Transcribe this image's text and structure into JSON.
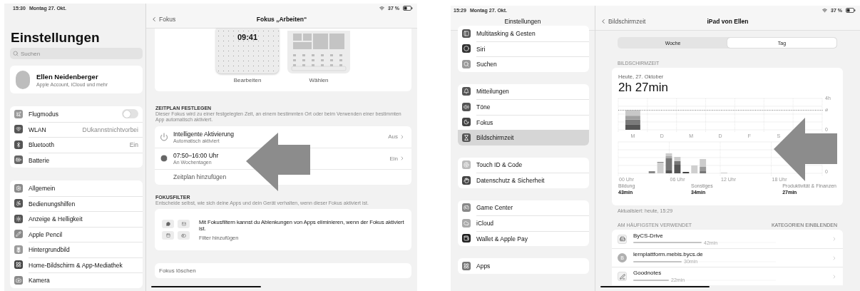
{
  "left_screen": {
    "status_bar": {
      "time": "15:30",
      "date": "Montag 27. Okt.",
      "battery": "37 %"
    },
    "sidebar": {
      "title": "Einstellungen",
      "search": {
        "placeholder": "Suchen"
      },
      "profile": {
        "name": "Ellen Neidenberger",
        "subtitle": "Apple Account, iCloud und mehr"
      },
      "groups": [
        [
          {
            "label": "Flugmodus",
            "kind": "toggle",
            "on": false
          },
          {
            "label": "WLAN",
            "kind": "value",
            "value": "DUkannstnichtvorbei"
          },
          {
            "label": "Bluetooth",
            "kind": "value",
            "value": "Ein"
          },
          {
            "label": "Batterie",
            "kind": "plain"
          }
        ],
        [
          {
            "label": "Allgemein",
            "kind": "plain"
          },
          {
            "label": "Bedienungshilfen",
            "kind": "plain"
          },
          {
            "label": "Anzeige & Helligkeit",
            "kind": "plain"
          },
          {
            "label": "Apple Pencil",
            "kind": "plain"
          },
          {
            "label": "Hintergrundbild",
            "kind": "plain"
          },
          {
            "label": "Home-Bildschirm & App-Mediathek",
            "kind": "plain"
          },
          {
            "label": "Kamera",
            "kind": "plain"
          }
        ]
      ]
    },
    "detail": {
      "back": "Fokus",
      "title": "Fokus „Arbeiten“",
      "previews": [
        {
          "kind": "lock",
          "time": "09:41",
          "label": "Bearbeiten"
        },
        {
          "kind": "home",
          "label": "Wählen"
        }
      ],
      "schedule": {
        "header": "ZEITPLAN FESTLEGEN",
        "description": "Dieser Fokus wird zu einer festgelegten Zeit, an einem bestimmten Ort oder beim Verwenden einer bestimmten App automatisch aktiviert.",
        "rows": [
          {
            "kind": "option",
            "title": "Intelligente Aktivierung",
            "subtitle": "Automatisch aktiviert",
            "value": "Aus"
          },
          {
            "kind": "option",
            "title": "07:50–16:00 Uhr",
            "subtitle": "An Wochentagen",
            "value": "Ein"
          },
          {
            "kind": "add",
            "title": "Zeitplan hinzufügen"
          }
        ]
      },
      "filters": {
        "header": "FOKUSFILTER",
        "description": "Entscheide selbst, wie sich deine Apps und dein Gerät verhalten, wenn dieser Fokus aktiviert ist.",
        "text": "Mit Fokusfiltern kannst du Ablenkungen von Apps eliminieren, wenn der Fokus aktiviert ist.",
        "action": "Filter hinzufügen"
      },
      "delete": "Fokus löschen"
    }
  },
  "right_screen": {
    "status_bar": {
      "time": "15:29",
      "date": "Montag 27. Okt.",
      "battery": "37 %"
    },
    "sidebar": {
      "title": "Einstellungen",
      "groups": [
        [
          {
            "label": "Multitasking & Gesten",
            "selected": false
          },
          {
            "label": "Siri",
            "selected": false
          },
          {
            "label": "Suchen",
            "selected": false
          }
        ],
        [
          {
            "label": "Mitteilungen",
            "selected": false
          },
          {
            "label": "Töne",
            "selected": false
          },
          {
            "label": "Fokus",
            "selected": false
          },
          {
            "label": "Bildschirmzeit",
            "selected": true
          }
        ],
        [
          {
            "label": "Touch ID & Code",
            "selected": false
          },
          {
            "label": "Datenschutz & Sicherheit",
            "selected": false
          }
        ],
        [
          {
            "label": "Game Center",
            "selected": false
          },
          {
            "label": "iCloud",
            "selected": false
          },
          {
            "label": "Wallet & Apple Pay",
            "selected": false
          }
        ],
        [
          {
            "label": "Apps",
            "selected": false
          }
        ]
      ]
    },
    "detail": {
      "back": "Bildschirmzeit",
      "title": "iPad von Ellen",
      "tabs": [
        {
          "label": "Woche",
          "selected": false
        },
        {
          "label": "Tag",
          "selected": true
        }
      ],
      "section_header": "BILDSCHIRMZEIT",
      "summary": {
        "date": "Heute, 27. Oktober",
        "total": "2h 27min",
        "chart_data": {
          "type": "bar",
          "stacked": true,
          "categories": [
            "M",
            "D",
            "M",
            "D",
            "F",
            "S"
          ],
          "series": [
            {
              "color": "#555555",
              "values": [
                0.7,
                null,
                null,
                null,
                null,
                null
              ]
            },
            {
              "color": "#7a7a7a",
              "values": [
                0.6,
                null,
                null,
                null,
                null,
                null
              ]
            },
            {
              "color": "#a0a0a0",
              "values": [
                0.5,
                null,
                null,
                null,
                null,
                null
              ]
            },
            {
              "color": "#c8c8c8",
              "values": [
                0.7,
                null,
                null,
                null,
                null,
                null
              ]
            }
          ],
          "ylim": [
            0,
            4
          ],
          "yticks": [
            0,
            {
              "value": 4,
              "label": "4h"
            }
          ]
        },
        "average_label": "⌀",
        "day_chart": {
          "x_labels": [
            "00 Uhr",
            "06 Uhr",
            "12 Uhr",
            "18 Uhr"
          ],
          "y_labels": [
            "0"
          ]
        },
        "categories": [
          {
            "name": "Bildung",
            "value": "43min"
          },
          {
            "name": "Sonstiges",
            "value": "34min"
          },
          {
            "name": "Produktivität & Finanzen",
            "value": "27min"
          }
        ]
      },
      "updated": "Aktualisiert: heute, 15:29",
      "most_used_header": "AM HÄUFIGSTEN VERWENDET",
      "categories_link": "KATEGORIEN EINBLENDEN",
      "apps": [
        {
          "kind": "glyph",
          "name": "ByCS-Drive",
          "time": "42min",
          "level": 0.48
        },
        {
          "kind": "letter",
          "letter": "B",
          "name": "lernplattform.mebis.bycs.de",
          "time": "30min",
          "level": 0.34
        },
        {
          "kind": "glyph",
          "name": "Goodnotes",
          "time": "22min",
          "level": 0.25
        }
      ]
    }
  }
}
